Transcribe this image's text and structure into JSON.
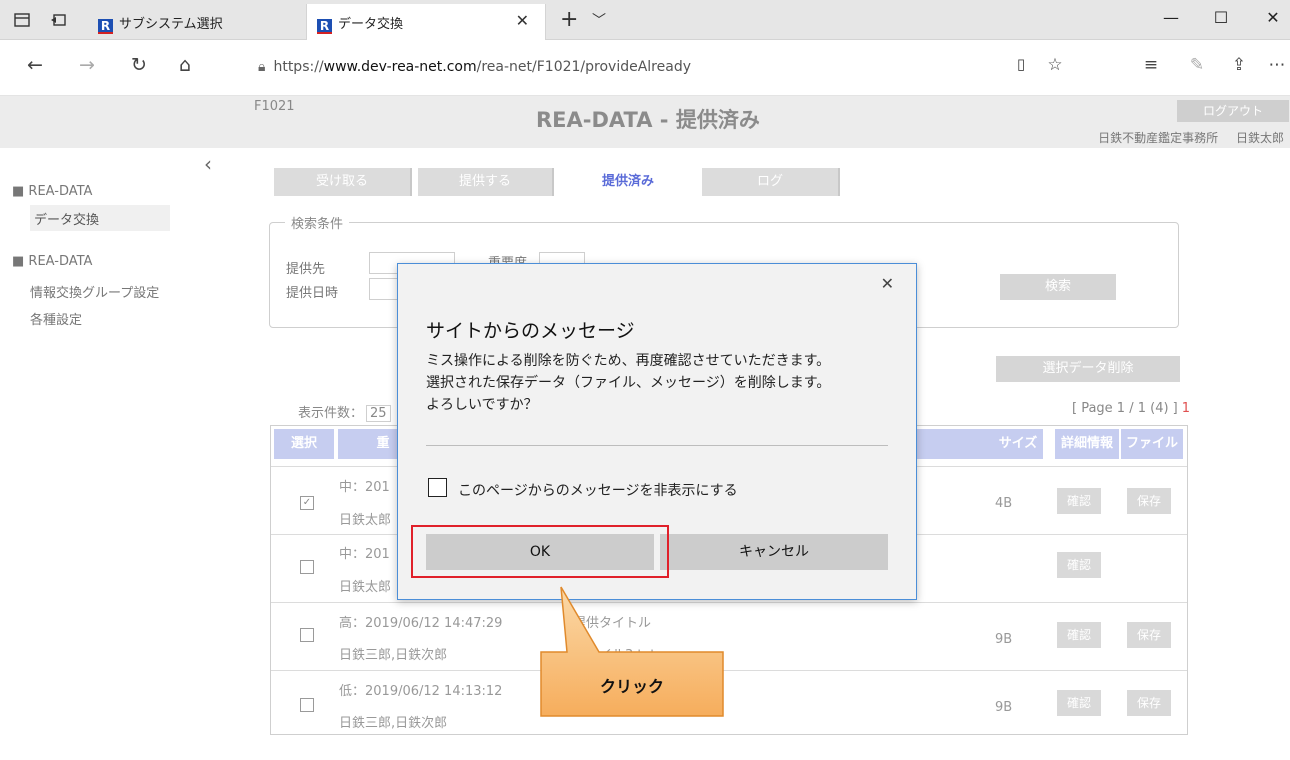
{
  "browser": {
    "tabs": [
      {
        "title": "サブシステム選択",
        "active": false
      },
      {
        "title": "データ交換",
        "active": true
      }
    ],
    "url_prefix": "https://",
    "url_host": "www.dev-rea-net.com",
    "url_path": "/rea-net/F1021/provideAlready"
  },
  "header": {
    "screen_id": "F1021",
    "title": "REA-DATA - 提供済み",
    "logout_label": "ログアウト",
    "office": "日鉄不動産鑑定事務所",
    "user": "日鉄太郎"
  },
  "sidebar": {
    "groups": [
      {
        "heading": "■ REA-DATA",
        "items": [
          "データ交換"
        ]
      },
      {
        "heading": "■ REA-DATA",
        "items": [
          "情報交換グループ設定",
          "各種設定"
        ]
      }
    ]
  },
  "tabs": {
    "receive": "受け取る",
    "provide": "提供する",
    "provided": "提供済み",
    "log": "ログ"
  },
  "search": {
    "legend": "検索条件",
    "provider_label": "提供先",
    "importance_label": "重要度",
    "datetime_label": "提供日時",
    "search_button": "検索"
  },
  "list": {
    "delete_button": "選択データ削除",
    "per_page_label": "表示件数：",
    "per_page_value": "25",
    "page_info": "[ Page 1 / 1 (4) ]",
    "page_current": "1",
    "columns": {
      "select": "選択",
      "importance": "重",
      "size": "サイズ",
      "detail": "詳細情報",
      "file": "ファイル"
    },
    "rows": [
      {
        "checked": true,
        "line1": "中：201",
        "line2": "日鉄太郎",
        "size": "4B",
        "detail": "確認",
        "file": "保存"
      },
      {
        "checked": false,
        "line1": "中：201",
        "line2": "日鉄太郎",
        "size": "",
        "detail": "確認",
        "file": ""
      },
      {
        "checked": false,
        "line1": "高：2019/06/12 14:47:29",
        "line2": "日鉄三郎,日鉄次郎",
        "title": "提供タイトル",
        "fname": "ファイル3.txt",
        "size": "9B",
        "detail": "確認",
        "file": "保存"
      },
      {
        "checked": false,
        "line1": "低：2019/06/12 14:13:12",
        "line2": "日鉄三郎,日鉄次郎",
        "size": "9B",
        "detail": "確認",
        "file": "保存"
      }
    ]
  },
  "dialog": {
    "title": "サイトからのメッセージ",
    "message_lines": [
      "ミス操作による削除を防ぐため、再度確認させていただきます。",
      "選択された保存データ（ファイル、メッセージ）を削除します。",
      "よろしいですか？"
    ],
    "suppress_label": "このページからのメッセージを非表示にする",
    "ok_label": "OK",
    "cancel_label": "キャンセル"
  },
  "callout": {
    "text": "クリック",
    "color": "#f9c184"
  }
}
